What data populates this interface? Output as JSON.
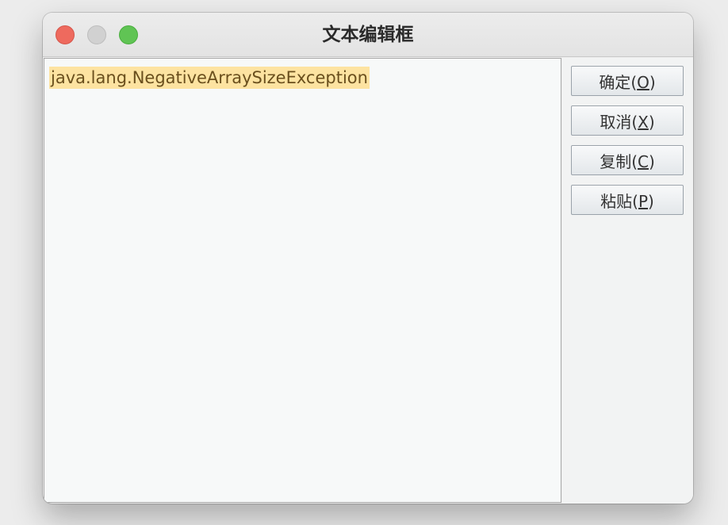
{
  "window": {
    "title": "文本编辑框"
  },
  "editor": {
    "text": "java.lang.NegativeArraySizeException"
  },
  "buttons": {
    "ok": {
      "label": "确定",
      "mnemonic": "O"
    },
    "cancel": {
      "label": "取消",
      "mnemonic": "X"
    },
    "copy": {
      "label": "复制",
      "mnemonic": "C"
    },
    "paste": {
      "label": "粘贴",
      "mnemonic": "P"
    }
  },
  "colors": {
    "close_button": "#ee6a5e",
    "minimize_button": "#d1d1d1",
    "zoom_button": "#60c454",
    "selection_highlight": "#fde3a1",
    "editor_background": "#f7f9f9"
  },
  "icons": {
    "close": "close-icon",
    "minimize": "minimize-icon",
    "zoom": "zoom-icon"
  }
}
